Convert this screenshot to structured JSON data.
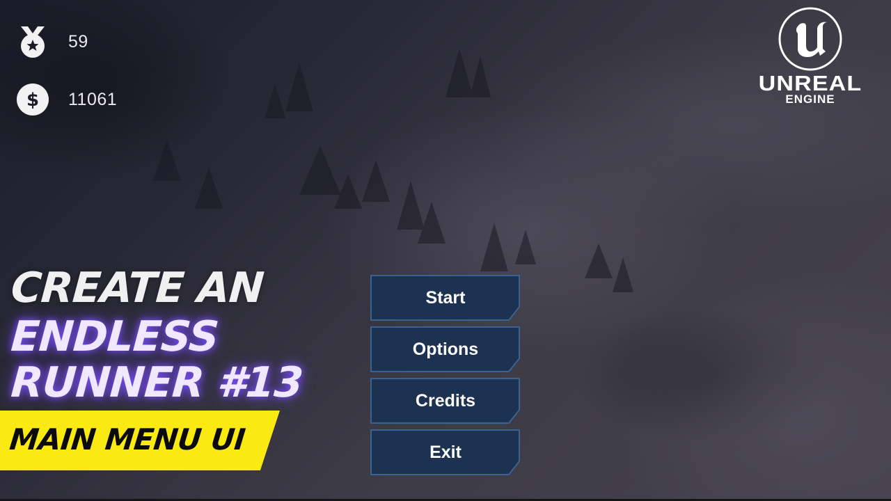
{
  "hud": {
    "medals": {
      "icon": "medal-star-icon",
      "value": "59"
    },
    "coins": {
      "icon": "dollar-coin-icon",
      "value": "11061"
    }
  },
  "logo": {
    "icon": "unreal-engine-emblem-icon",
    "word": "UNREAL",
    "sub": "ENGINE"
  },
  "thumbnail": {
    "line1": "CREATE AN",
    "line2": "ENDLESS",
    "line3": "RUNNER #13",
    "banner": "MAIN MENU UI"
  },
  "menu": {
    "buttons": [
      {
        "label": "Start"
      },
      {
        "label": "Options"
      },
      {
        "label": "Credits"
      },
      {
        "label": "Exit"
      }
    ]
  },
  "colors": {
    "button_fill": "#1d3150",
    "button_border": "#3a6293",
    "banner_yellow": "#fbea12",
    "title_glow": "#7b4dff"
  }
}
